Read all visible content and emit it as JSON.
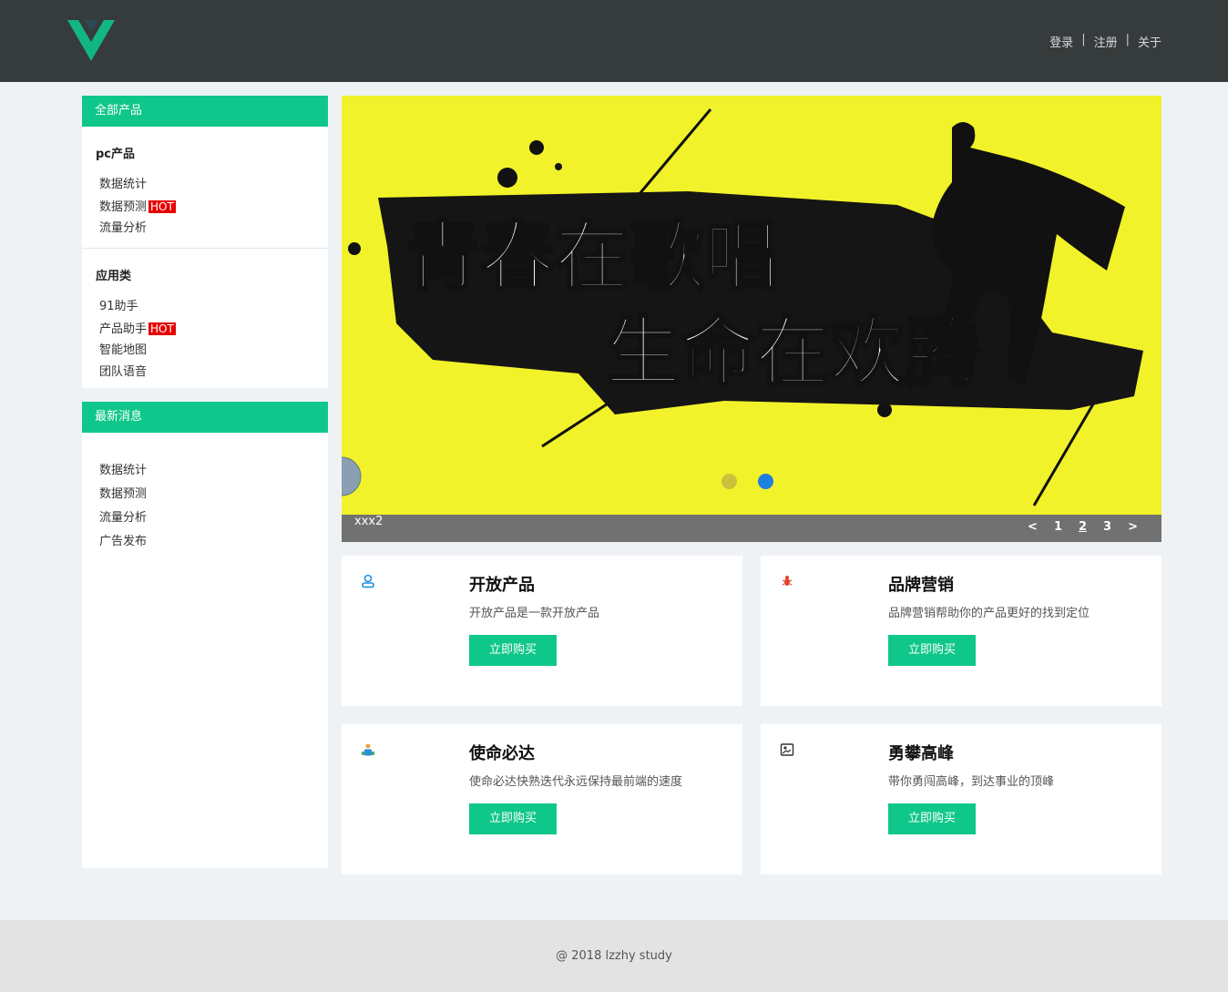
{
  "header": {
    "nav": [
      "登录",
      "注册",
      "关于"
    ],
    "separator": "|"
  },
  "sidebar": {
    "products_title": "全部产品",
    "categories": [
      {
        "title": "pc产品",
        "items": [
          {
            "label": "数据统计",
            "hot": ""
          },
          {
            "label": "数据预测",
            "hot": "HOT"
          },
          {
            "label": "流量分析",
            "hot": ""
          }
        ]
      },
      {
        "title": "应用类",
        "items": [
          {
            "label": "91助手",
            "hot": ""
          },
          {
            "label": "产品助手",
            "hot": "HOT"
          },
          {
            "label": "智能地图",
            "hot": ""
          },
          {
            "label": "团队语音",
            "hot": ""
          }
        ]
      }
    ],
    "news_title": "最新消息",
    "news_items": [
      "数据统计",
      "数据预测",
      "流量分析",
      "广告发布"
    ]
  },
  "banner": {
    "line1": "青春在歌唱",
    "line2": "生命在欢腾",
    "caption": "xxx2",
    "prev": "<",
    "next": ">",
    "pages": [
      "1",
      "2",
      "3"
    ],
    "active_page": 2,
    "colors": {
      "background": "#f0ef2a",
      "bar": "#717171",
      "dot_active": "#1e7fe0",
      "dot_inactive": "#c9c23a"
    }
  },
  "cards": [
    {
      "title": "开放产品",
      "desc": "开放产品是一款开放产品",
      "button": "立即购买",
      "icon": "user-icon"
    },
    {
      "title": "品牌营销",
      "desc": "品牌营销帮助你的产品更好的找到定位",
      "button": "立即购买",
      "icon": "bug-icon"
    },
    {
      "title": "使命必达",
      "desc": "使命必达快熟迭代永远保持最前端的速度",
      "button": "立即购买",
      "icon": "team-icon"
    },
    {
      "title": "勇攀高峰",
      "desc": "带你勇闯高峰，到达事业的顶峰",
      "button": "立即购买",
      "icon": "image-icon"
    }
  ],
  "footer": {
    "text": "@ 2018 lzzhy study"
  },
  "theme": {
    "accent": "#0fc78a",
    "header_bg": "#363b3b",
    "hot": "#e60000"
  }
}
